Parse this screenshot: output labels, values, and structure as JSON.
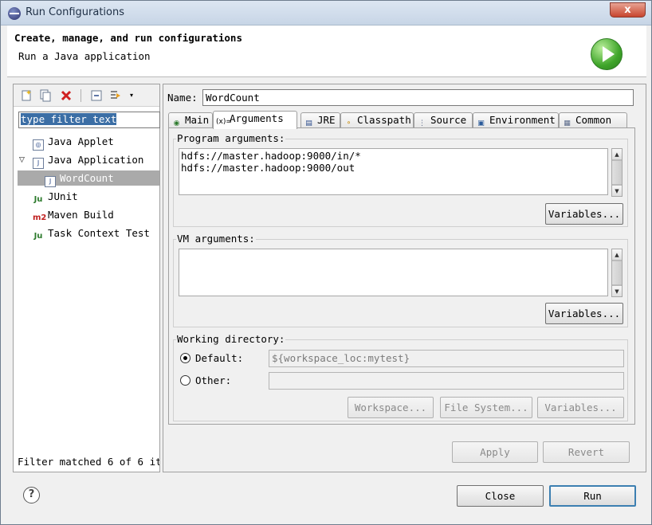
{
  "window": {
    "title": "Run Configurations",
    "close_glyph": "x"
  },
  "header": {
    "title": "Create, manage, and run configurations",
    "subtitle": "Run a Java application"
  },
  "left": {
    "filter_placeholder": "type filter text",
    "tree": [
      {
        "label": "Java Applet",
        "icon": "java-applet-icon"
      },
      {
        "label": "Java Application",
        "icon": "java-application-icon",
        "expanded": true
      },
      {
        "label": "WordCount",
        "icon": "java-class-icon",
        "selected": true
      },
      {
        "label": "JUnit",
        "icon": "junit-icon"
      },
      {
        "label": "Maven Build",
        "icon": "maven-icon"
      },
      {
        "label": "Task Context Test",
        "icon": "task-context-test-icon"
      }
    ],
    "filter_status": "Filter matched 6 of 6 it"
  },
  "config": {
    "name_label": "Name:",
    "name_value": "WordCount",
    "tabs": [
      {
        "label": "Main",
        "icon": "main-icon"
      },
      {
        "label": "Arguments",
        "icon": "arguments-icon",
        "active": true
      },
      {
        "label": "JRE",
        "icon": "jre-icon"
      },
      {
        "label": "Classpath",
        "icon": "classpath-icon"
      },
      {
        "label": "Source",
        "icon": "source-icon"
      },
      {
        "label": "Environment",
        "icon": "environment-icon"
      },
      {
        "label": "Common",
        "icon": "common-icon"
      }
    ],
    "program_args_label": "Program arguments:",
    "program_args_value": "hdfs://master.hadoop:9000/in/*\nhdfs://master.hadoop:9000/out",
    "variables_label": "Variables...",
    "vm_args_label": "VM arguments:",
    "vm_args_value": "",
    "workdir_label": "Working directory:",
    "default_label": "Default:",
    "default_value": "${workspace_loc:mytest}",
    "other_label": "Other:",
    "other_value": "",
    "workspace_btn": "Workspace...",
    "filesystem_btn": "File System...",
    "apply_btn": "Apply",
    "revert_btn": "Revert"
  },
  "footer": {
    "help_glyph": "?",
    "close_btn": "Close",
    "run_btn": "Run"
  }
}
